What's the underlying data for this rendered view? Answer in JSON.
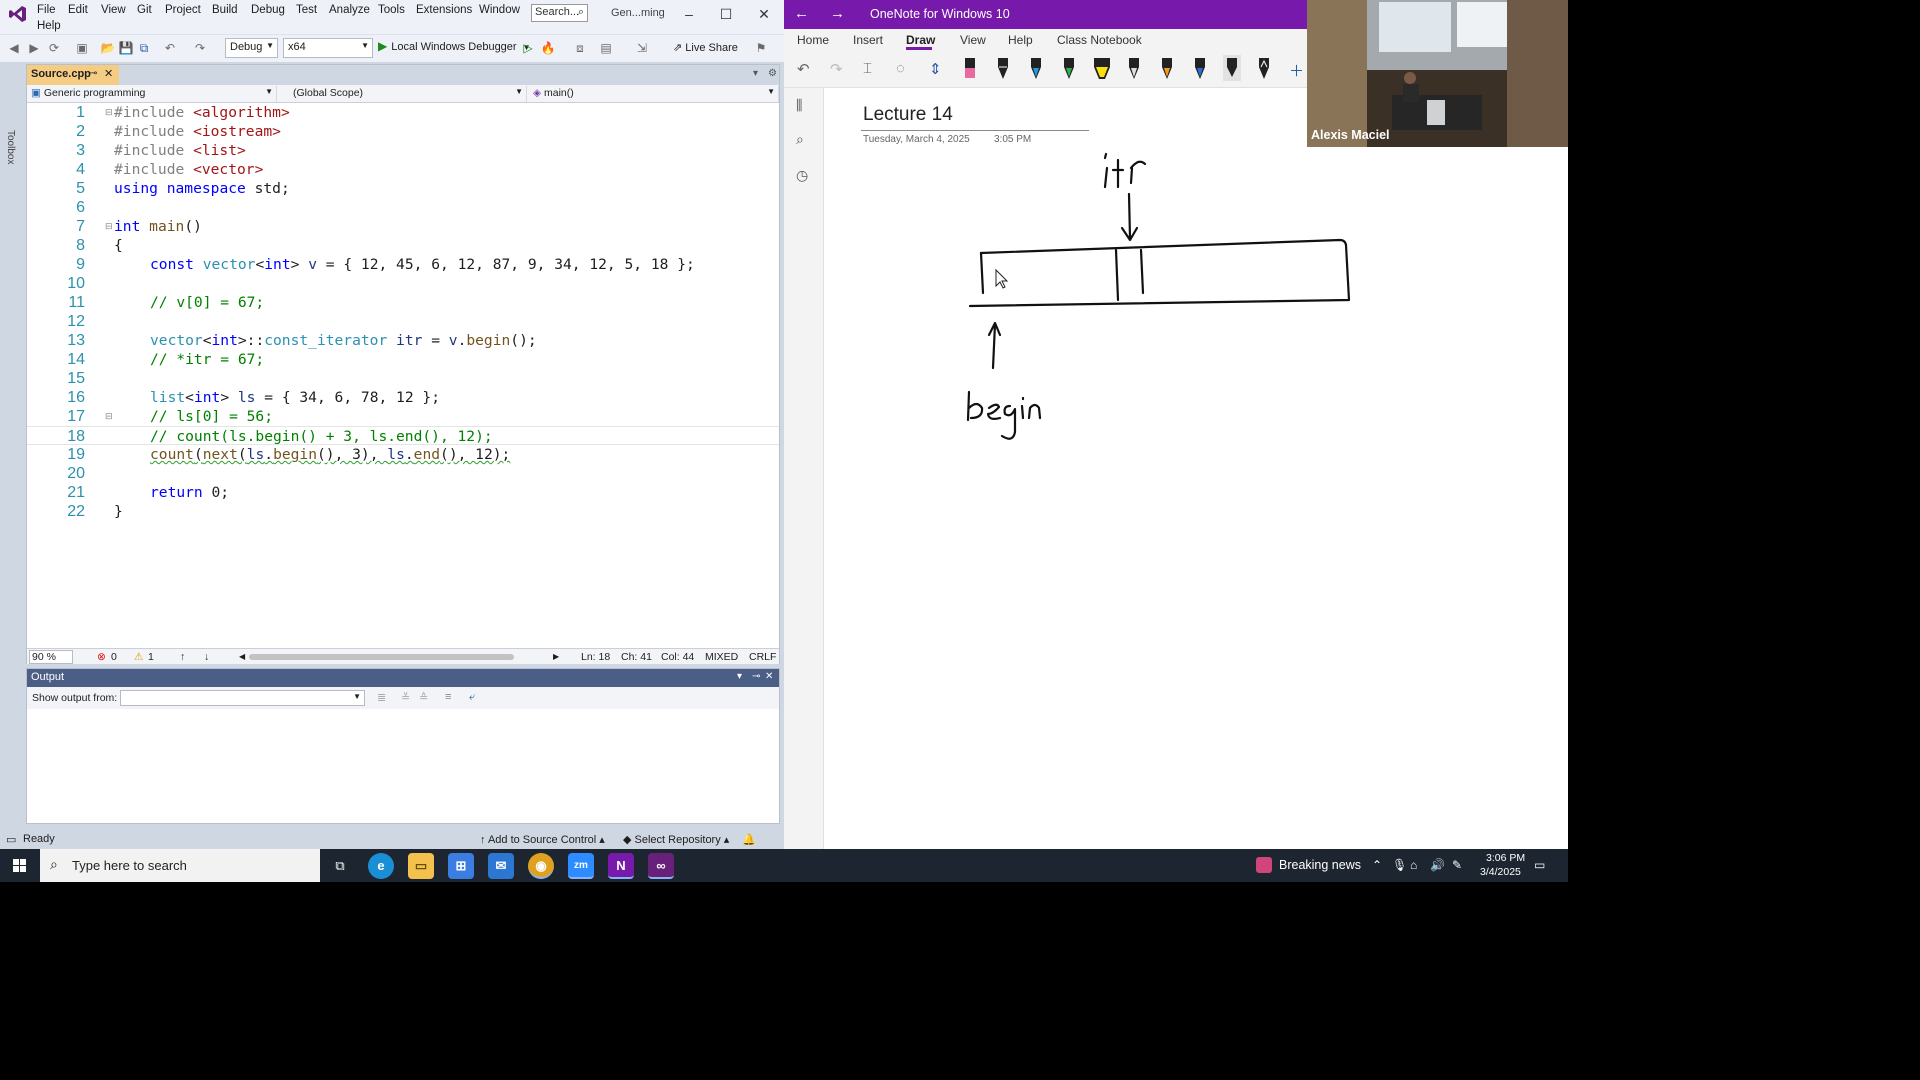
{
  "vs": {
    "menu": [
      "File",
      "Edit",
      "View",
      "Git",
      "Project",
      "Build",
      "Debug",
      "Test",
      "Analyze",
      "Tools",
      "Extensions",
      "Window",
      "Help"
    ],
    "search_placeholder": "Search...",
    "solution_name": "Gen...ming",
    "toolbar": {
      "config": "Debug",
      "platform": "x64",
      "debugger": "Local Windows Debugger",
      "live_share": "Live Share"
    },
    "toolbox_label": "Toolbox",
    "tab": {
      "title": "Source.cpp"
    },
    "nav": {
      "project": "Generic programming",
      "scope": "(Global Scope)",
      "member": "main()"
    },
    "code_lines": [
      {
        "n": "1"
      },
      {
        "n": "2"
      },
      {
        "n": "3"
      },
      {
        "n": "4"
      },
      {
        "n": "5"
      },
      {
        "n": "6"
      },
      {
        "n": "7"
      },
      {
        "n": "8"
      },
      {
        "n": "9"
      },
      {
        "n": "10"
      },
      {
        "n": "11"
      },
      {
        "n": "12"
      },
      {
        "n": "13"
      },
      {
        "n": "14"
      },
      {
        "n": "15"
      },
      {
        "n": "16"
      },
      {
        "n": "17"
      },
      {
        "n": "18"
      },
      {
        "n": "19"
      },
      {
        "n": "20"
      },
      {
        "n": "21"
      },
      {
        "n": "22"
      }
    ],
    "code": {
      "l1": [
        "#include ",
        "<algorithm>"
      ],
      "l2": [
        "#include ",
        "<iostream>"
      ],
      "l3": [
        "#include ",
        "<list>"
      ],
      "l4": [
        "#include ",
        "<vector>"
      ],
      "l5": [
        "using",
        " ",
        "namespace",
        " std;"
      ],
      "l7": [
        "int",
        " ",
        "main",
        "()"
      ],
      "l8": "{",
      "l9": [
        "const",
        " ",
        "vector",
        "<",
        "int",
        "> ",
        "v",
        " = { 12, 45, 6, 12, 87, 9, 34, 12, 5, 18 };"
      ],
      "l11": "// v[0] = 67;",
      "l13": [
        "vector",
        "<",
        "int",
        ">::",
        "const_iterator",
        " ",
        "itr",
        " = ",
        "v",
        ".",
        "begin",
        "();"
      ],
      "l14": "// *itr = 67;",
      "l16": [
        "list",
        "<",
        "int",
        "> ",
        "ls",
        " = { 34, 6, 78, 12 };"
      ],
      "l17": "// ls[0] = 56;",
      "l18": "// count(ls.begin() + 3, ls.end(), 12);",
      "l19": [
        "count",
        "(",
        "next",
        "(",
        "ls",
        ".",
        "begin",
        "(), 3), ",
        "ls",
        ".",
        "end",
        "(), 12);"
      ],
      "l21": [
        "return",
        " 0;"
      ],
      "l22": "}"
    },
    "editor_status": {
      "zoom": "90 %",
      "errors": "0",
      "warnings": "1",
      "ln": "Ln: 18",
      "ch": "Ch: 41",
      "col": "Col: 44",
      "mode": "MIXED",
      "eol": "CRLF"
    },
    "output": {
      "title": "Output",
      "show_from_label": "Show output from:",
      "show_from_value": ""
    },
    "statusbar": {
      "ready": "Ready",
      "source_control": "Add to Source Control",
      "repo": "Select Repository"
    }
  },
  "onenote": {
    "title": "OneNote for Windows 10",
    "tabs": [
      "Home",
      "Insert",
      "Draw",
      "View",
      "Help",
      "Class Notebook"
    ],
    "active_tab": "Draw",
    "page": {
      "title": "Lecture 14",
      "date": "Tuesday, March 4, 2025",
      "time": "3:05 PM"
    },
    "ink_words": [
      "itr",
      "begin"
    ]
  },
  "webcam": {
    "name": "Alexis Maciel"
  },
  "taskbar": {
    "search_placeholder": "Type here to search",
    "news": "Breaking news",
    "time": "3:06 PM",
    "date": "3/4/2025",
    "apps": [
      "task-view",
      "edge",
      "file-explorer",
      "store",
      "mail",
      "chrome",
      "zoom",
      "onenote",
      "visual-studio"
    ]
  },
  "colors": {
    "vs_accent": "#4b5e86",
    "onenote_purple": "#7719aa",
    "keyword": "#0000ff",
    "type": "#2b91af",
    "string": "#a31515",
    "comment": "#008000"
  }
}
